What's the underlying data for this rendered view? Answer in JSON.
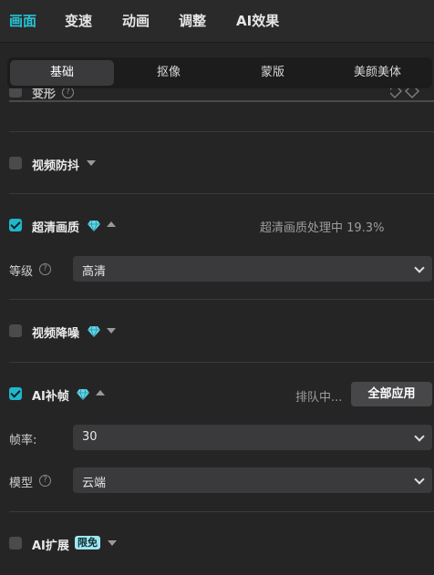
{
  "top_tabs": [
    {
      "label": "画面",
      "active": true
    },
    {
      "label": "变速",
      "active": false
    },
    {
      "label": "动画",
      "active": false
    },
    {
      "label": "调整",
      "active": false
    },
    {
      "label": "AI效果",
      "active": false
    }
  ],
  "sub_tabs": [
    {
      "label": "基础",
      "active": true
    },
    {
      "label": "抠像",
      "active": false
    },
    {
      "label": "蒙版",
      "active": false
    },
    {
      "label": "美颜美体",
      "active": false
    }
  ],
  "sections": {
    "deform": {
      "title": "变形",
      "checked": false
    },
    "stabilize": {
      "title": "视频防抖",
      "checked": false
    },
    "super_resolution": {
      "title": "超清画质",
      "checked": true,
      "status": "超清画质处理中 19.3%",
      "progress_percent": 19.3,
      "level_label": "等级",
      "level_value": "高清"
    },
    "denoise": {
      "title": "视频降噪",
      "checked": false
    },
    "frame_interp": {
      "title": "AI补帧",
      "checked": true,
      "status": "排队中...",
      "apply_all": "全部应用",
      "framerate_label": "帧率:",
      "framerate_value": "30",
      "model_label": "模型",
      "model_value": "云端"
    },
    "ai_extend": {
      "title": "AI扩展",
      "checked": false,
      "badge": "限免"
    }
  },
  "colors": {
    "accent": "#27c3d6",
    "background": "#252526",
    "panel": "#3a3a3c",
    "badge": "#9fe6ef"
  },
  "icons": [
    "diamond-vip-icon",
    "help-icon",
    "caret-down-icon",
    "caret-up-icon",
    "chevron-down-icon",
    "checkbox-icon"
  ]
}
